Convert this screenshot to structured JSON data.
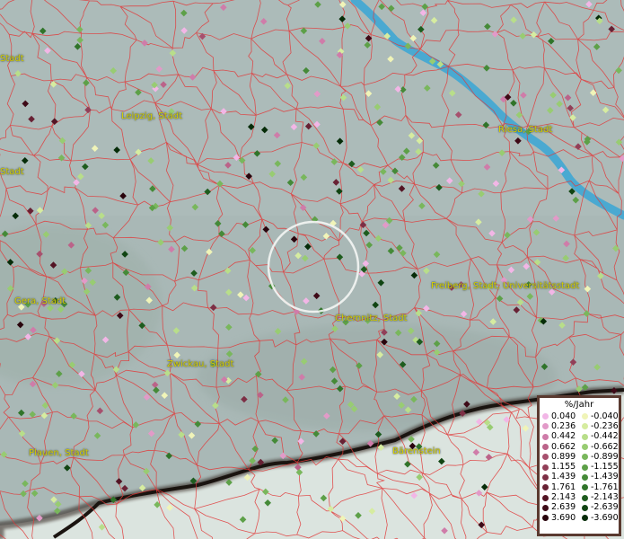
{
  "cities": [
    {
      "id": "leipzig",
      "label": "Leipzig, Stadt"
    },
    {
      "id": "riesa",
      "label": "Riesa, Stadt"
    },
    {
      "id": "gera",
      "label": "Gera, Stadt"
    },
    {
      "id": "freiberg",
      "label": "Freiberg, Stadt, Universitätsstadt"
    },
    {
      "id": "chemnitz",
      "label": "Chemnitz, Stadt"
    },
    {
      "id": "zwickau",
      "label": "Zwickau, Stadt"
    },
    {
      "id": "plauen",
      "label": "Plauen, Stadt"
    },
    {
      "id": "baerenstein",
      "label": "Bärenstein"
    },
    {
      "id": "left1",
      "label": "Stadt"
    },
    {
      "id": "left2",
      "label": "Stadt"
    }
  ],
  "legend": {
    "title": "%/Jahr",
    "positive": [
      {
        "value": "0.040",
        "color": "#f2b6e6"
      },
      {
        "value": "0.236",
        "color": "#e29ac8"
      },
      {
        "value": "0.442",
        "color": "#cf7ca9"
      },
      {
        "value": "0.662",
        "color": "#bb6389"
      },
      {
        "value": "0.899",
        "color": "#a7506e"
      },
      {
        "value": "1.155",
        "color": "#923f58"
      },
      {
        "value": "1.439",
        "color": "#7d2f45"
      },
      {
        "value": "1.761",
        "color": "#682134"
      },
      {
        "value": "2.143",
        "color": "#531424"
      },
      {
        "value": "2.639",
        "color": "#3e0a17"
      },
      {
        "value": "3.690",
        "color": "#29040c"
      }
    ],
    "negative": [
      {
        "value": "-0.040",
        "color": "#f0f4b8"
      },
      {
        "value": "-0.236",
        "color": "#d6eca0"
      },
      {
        "value": "-0.442",
        "color": "#b8de8a"
      },
      {
        "value": "-0.662",
        "color": "#98cc72"
      },
      {
        "value": "-0.899",
        "color": "#79b75c"
      },
      {
        "value": "-1.155",
        "color": "#5da048"
      },
      {
        "value": "-1.439",
        "color": "#458a38"
      },
      {
        "value": "-1.761",
        "color": "#30742a"
      },
      {
        "value": "-2.143",
        "color": "#1e5c1e"
      },
      {
        "value": "-2.639",
        "color": "#104412"
      },
      {
        "value": "-3.690",
        "color": "#062c08"
      }
    ]
  },
  "colors": {
    "river": "#3fa7d4",
    "boundary": "#e03a3a",
    "border_dark": "#1a1410"
  },
  "icons": {
    "selection": "selection-circle-icon"
  }
}
